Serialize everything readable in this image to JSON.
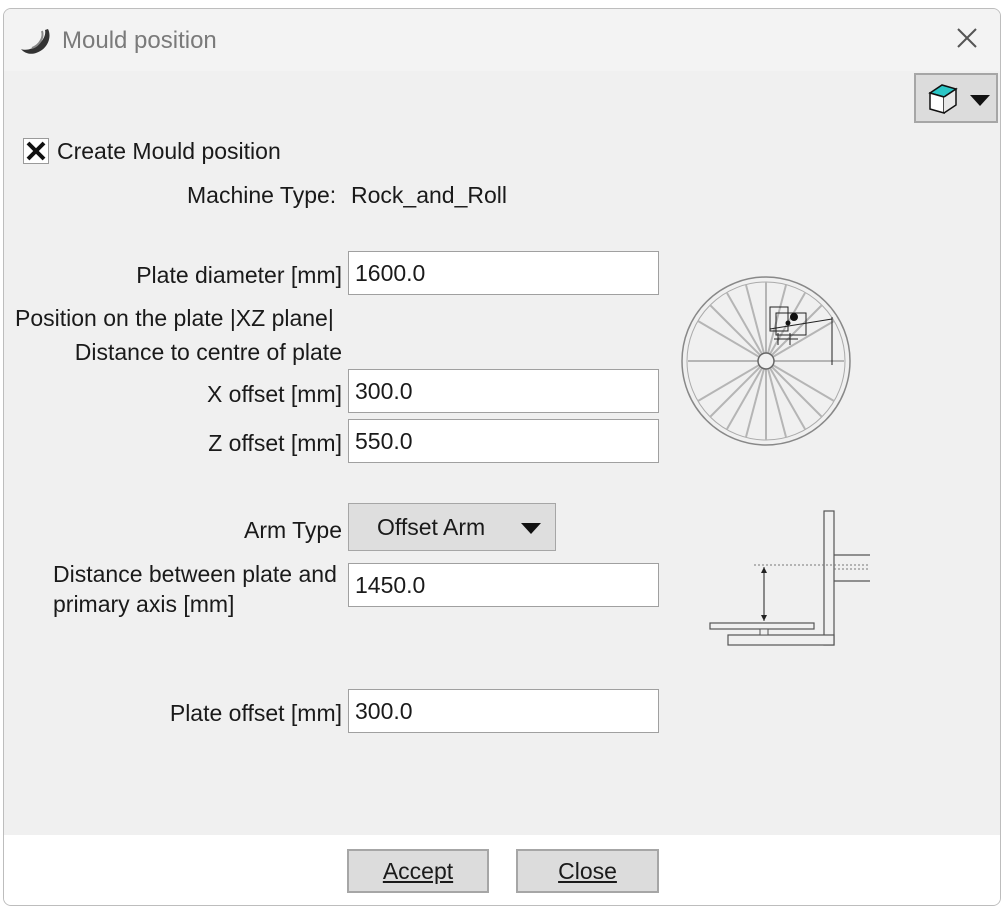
{
  "window": {
    "title": "Mould position",
    "icons": {
      "app": "swoosh-logo-icon",
      "close": "close-icon",
      "menu": "document-menu-icon"
    }
  },
  "create_mould": {
    "label": "Create Mould position",
    "checked": true
  },
  "machine_type": {
    "label": "Machine Type:",
    "value": "Rock_and_Roll"
  },
  "plate_diameter": {
    "label": "Plate diameter [mm]",
    "value": "1600.0"
  },
  "position": {
    "heading": "Position on the plate |XZ plane|",
    "subheading": "Distance to centre of plate",
    "x_label": "X offset [mm]",
    "x_value": "300.0",
    "z_label": "Z offset [mm]",
    "z_value": "550.0"
  },
  "arm": {
    "type_label": "Arm Type",
    "type_value": "Offset Arm",
    "distance_label_1": "Distance between plate and",
    "distance_label_2": "primary axis [mm]",
    "distance_value": "1450.0"
  },
  "plate_offset": {
    "label": "Plate offset [mm]",
    "value": "300.0"
  },
  "buttons": {
    "accept": "Accept",
    "close": "Close"
  },
  "colors": {
    "dialog_bg": "#f0f0f0",
    "button_bg": "#dcdcdc",
    "menu_icon_accent": "#2cc6c6"
  }
}
